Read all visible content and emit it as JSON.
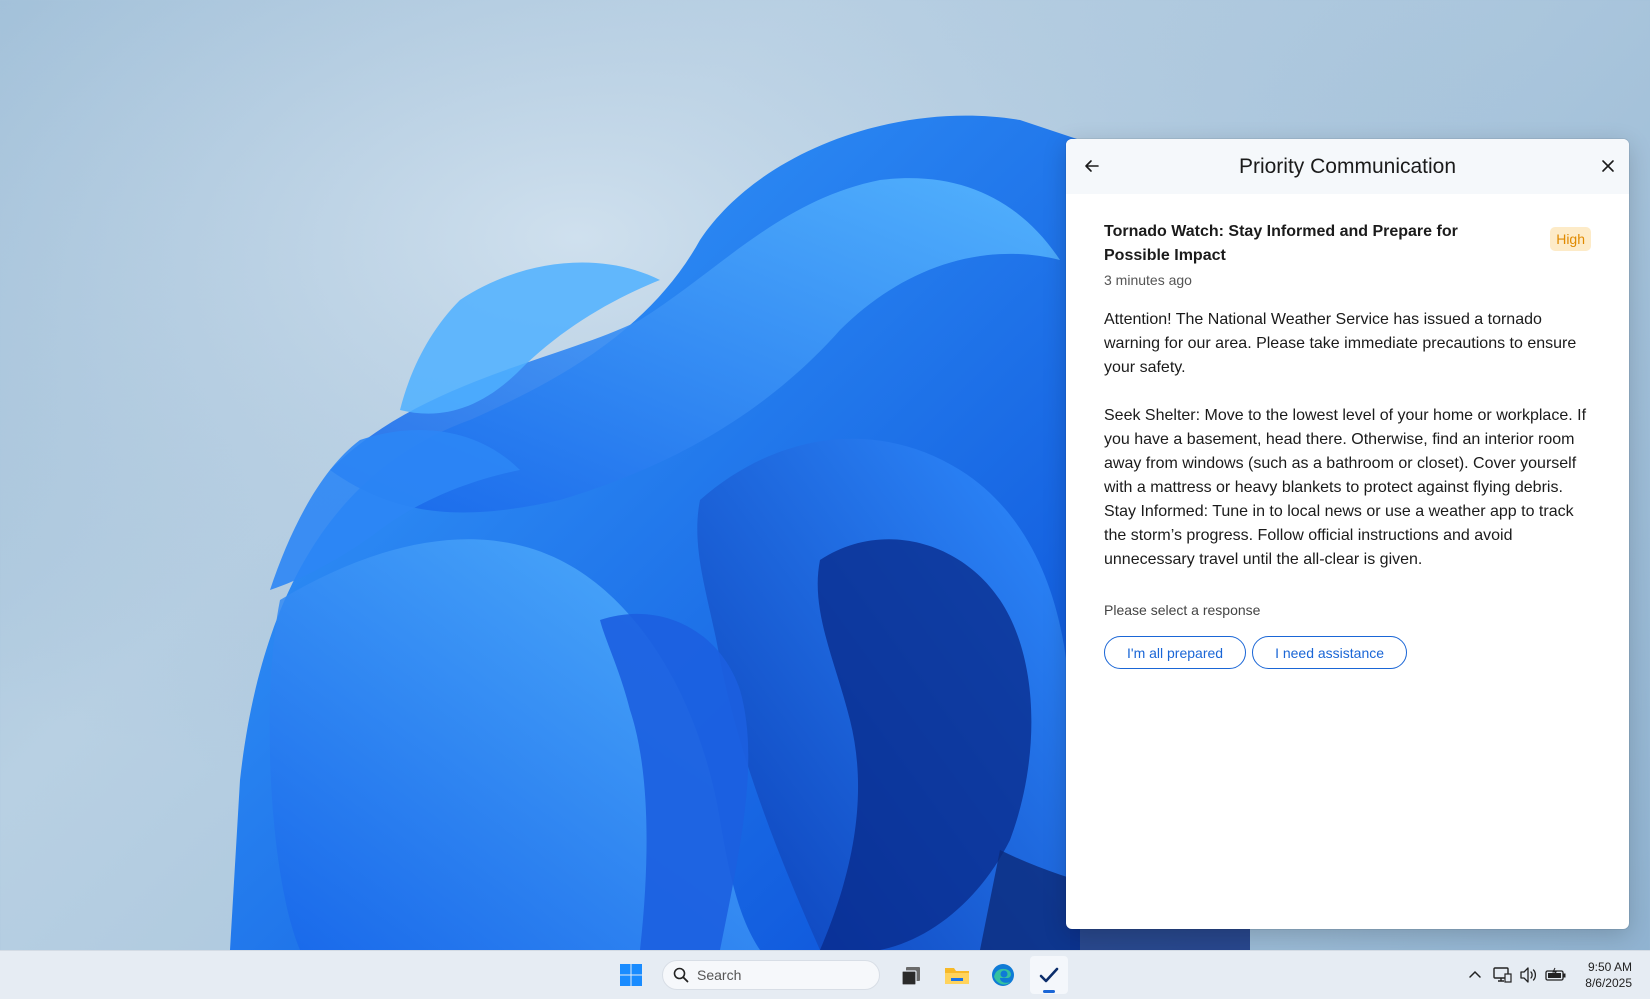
{
  "panel": {
    "title": "Priority Communication",
    "back_icon": "arrow-left-icon",
    "close_icon": "close-icon"
  },
  "message": {
    "title": "Tornado Watch: Stay Informed and Prepare for Possible Impact",
    "priority": "High",
    "priority_color": "#e08a00",
    "timestamp": "3 minutes ago",
    "paragraph_1": "Attention! The National Weather Service has issued a tornado warning for our area. Please take immediate precautions to ensure your safety.",
    "paragraph_2": "Seek Shelter: Move to the lowest level of your home or workplace. If you have a basement, head there. Otherwise, find an interior room away from windows (such as a bathroom or closet). Cover yourself with a mattress or heavy blankets to protect against flying debris.",
    "paragraph_3": "Stay Informed: Tune in to local news or use a weather app to track the storm’s progress. Follow official instructions and avoid unnecessary travel until the all-clear is given."
  },
  "response": {
    "prompt": "Please select a response",
    "options": [
      "I'm all prepared",
      "I need assistance"
    ],
    "accent_color": "#1a66d6"
  },
  "taskbar": {
    "start_icon": "windows-start-icon",
    "search_placeholder": "Search",
    "apps": [
      "task-view-icon",
      "file-explorer-icon",
      "edge-browser-icon",
      "checkmark-app-icon"
    ],
    "tray_icons": [
      "chevron-up-icon",
      "network-icon",
      "volume-icon",
      "battery-icon"
    ],
    "time": "9:50 AM",
    "date": "8/6/2025"
  }
}
